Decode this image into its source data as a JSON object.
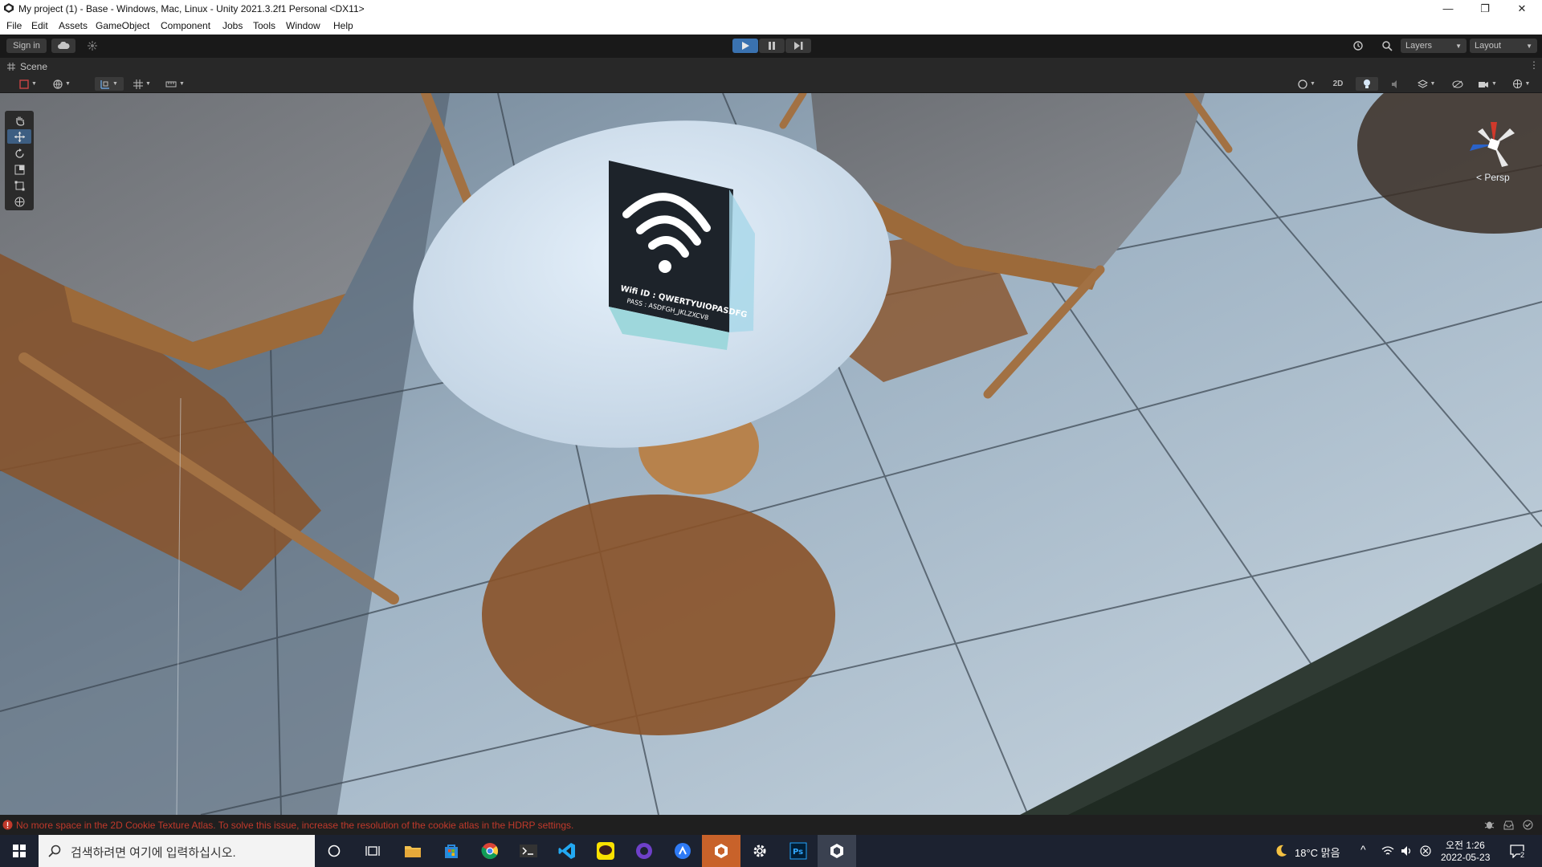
{
  "window": {
    "title": "My project (1) - Base - Windows, Mac, Linux - Unity 2021.3.2f1 Personal <DX11>",
    "minimize": "—",
    "maximize": "❐",
    "close": "✕"
  },
  "menu": [
    "File",
    "Edit",
    "Assets",
    "GameObject",
    "Component",
    "Jobs",
    "Tools",
    "Window",
    "Help"
  ],
  "toolbar": {
    "sign_in": "Sign in",
    "layers": "Layers",
    "layout": "Layout"
  },
  "scene_tab": {
    "label": "Scene",
    "toggle_2d": "2D"
  },
  "viewport": {
    "projection_label": "Persp",
    "wifi_sign_line1": "Wifi ID : QWERTYUIOPASDFG",
    "wifi_sign_line2": "PASS : ASDFGH_JKLZXCV8"
  },
  "status": {
    "error_message": "No more space in the 2D Cookie Texture Atlas. To solve this issue, increase the resolution of the cookie atlas in the HDRP settings."
  },
  "taskbar": {
    "search_placeholder": "검색하려면 여기에 입력하십시오.",
    "weather": "18°C 맑음",
    "time": "오전 1:26",
    "date": "2022-05-23",
    "notification_count": "2"
  },
  "colors": {
    "play_active": "#3a72b0",
    "error": "#c0392b",
    "taskbar_bg": "#1c2230"
  }
}
